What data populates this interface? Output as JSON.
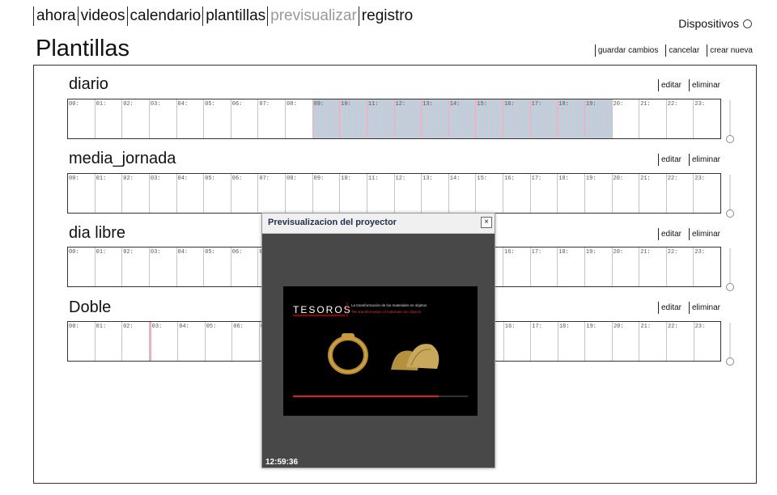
{
  "nav": [
    {
      "label": "ahora",
      "active": true
    },
    {
      "label": "videos",
      "active": true
    },
    {
      "label": "calendario",
      "active": true
    },
    {
      "label": "plantillas",
      "active": true
    },
    {
      "label": "previsualizar",
      "active": false
    },
    {
      "label": "registro",
      "active": true
    }
  ],
  "devices": {
    "label": "Dispositivos"
  },
  "page": {
    "title": "Plantillas"
  },
  "actions": {
    "save": "guardar cambios",
    "cancel": "cancelar",
    "create": "crear nueva"
  },
  "hours": [
    "00:",
    "01:",
    "02:",
    "03:",
    "04:",
    "05:",
    "06:",
    "07:",
    "08:",
    "09:",
    "10:",
    "11:",
    "12:",
    "13:",
    "14:",
    "15:",
    "16:",
    "17:",
    "18:",
    "19:",
    "20:",
    "21:",
    "22:",
    "23:"
  ],
  "templates": [
    {
      "name": "diario",
      "edit": "editar",
      "delete": "eliminar",
      "active_from": 9.5,
      "active_to": 20
    },
    {
      "name": "media_jornada",
      "edit": "editar",
      "delete": "eliminar"
    },
    {
      "name": "dia libre",
      "edit": "editar",
      "delete": "eliminar"
    },
    {
      "name": "Doble",
      "edit": "editar",
      "delete": "eliminar",
      "marker_at": 3
    }
  ],
  "modal": {
    "title": "Previsualizacion del proyector",
    "close": "×",
    "time": "12:59:36",
    "slide": {
      "brand": "TESOROS",
      "line1": "La transformación de los materiales en objetos",
      "line2": "The transformation of materials into objects"
    }
  },
  "colors": {
    "stripe_pink": "#ecb9d0",
    "stripe_blue": "#a8dbe0",
    "disabled_nav": "#9a9a9a",
    "accent_red": "#c00000"
  }
}
